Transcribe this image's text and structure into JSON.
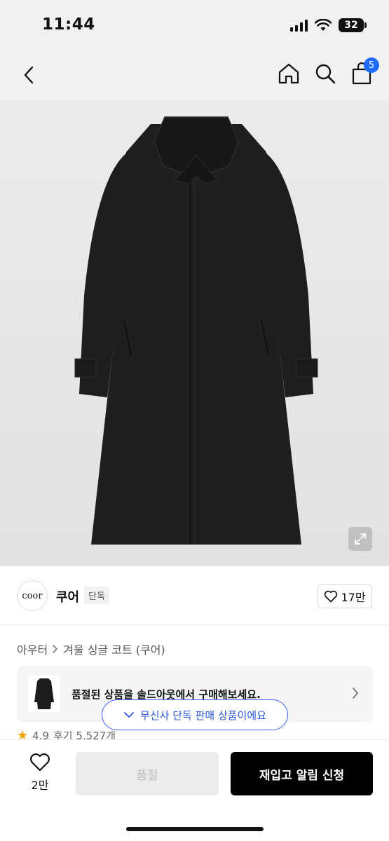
{
  "status": {
    "time": "11:44",
    "battery": "32"
  },
  "nav": {
    "cart_count": "5"
  },
  "brand": {
    "logo_text": "coor",
    "name": "쿠어",
    "tag": "단독",
    "likes": "17만"
  },
  "breadcrumb": {
    "category": "아우터",
    "product": "겨울 싱글 코트 (쿠어)"
  },
  "soldout_card": {
    "text": "품절된 상품을 솔드아웃에서 구매해보세요."
  },
  "exclusive_pill": {
    "text": "무신사 단독 판매 상품이에요"
  },
  "rating": {
    "score": "4.9",
    "reviews": "후기 5,527개"
  },
  "bottom": {
    "heart_count": "2만",
    "soldout_label": "품절",
    "restock_label": "재입고 알림 신청"
  }
}
